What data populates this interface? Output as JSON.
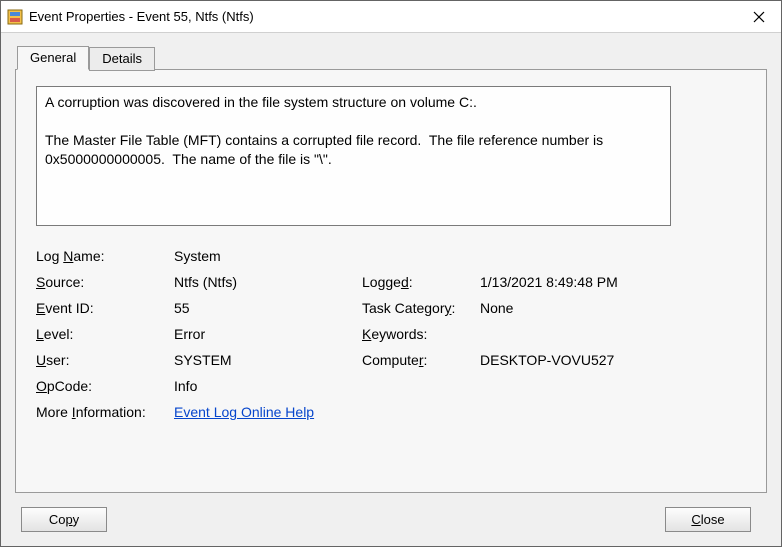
{
  "window": {
    "title": "Event Properties - Event 55, Ntfs (Ntfs)"
  },
  "tabs": {
    "general": "General",
    "details": "Details"
  },
  "description": "A corruption was discovered in the file system structure on volume C:.\n\nThe Master File Table (MFT) contains a corrupted file record.  The file reference number is 0x5000000000005.  The name of the file is \"\\\".",
  "fields": {
    "log_name_label": "Log Name:",
    "log_name": "System",
    "source_label_pre": "S",
    "source_label_post": "ource:",
    "source": "Ntfs (Ntfs)",
    "logged_label_pre": "Logge",
    "logged_label_u": "d",
    "logged_label_post": ":",
    "logged": "1/13/2021 8:49:48 PM",
    "event_id_label_u": "E",
    "event_id_label_post": "vent ID:",
    "event_id": "55",
    "task_cat_label": "Task Categor",
    "task_cat_label_u": "y",
    "task_cat_label_post": ":",
    "task_category": "None",
    "level_label_u": "L",
    "level_label_post": "evel:",
    "level": "Error",
    "keywords_label_u": "K",
    "keywords_label_post": "eywords:",
    "keywords": "",
    "user_label_u": "U",
    "user_label_post": "ser:",
    "user": "SYSTEM",
    "computer_label": "Compute",
    "computer_label_u": "r",
    "computer_label_post": ":",
    "computer": "DESKTOP-VOVU527",
    "opcode_label_u": "O",
    "opcode_label_post": "pCode:",
    "opcode": "Info",
    "more_info_label": "More Information:",
    "more_info_link": "Event Log Online Help"
  },
  "buttons": {
    "copy_pre": "Co",
    "copy_u": "p",
    "copy_post": "y",
    "close_u": "C",
    "close_post": "lose"
  }
}
